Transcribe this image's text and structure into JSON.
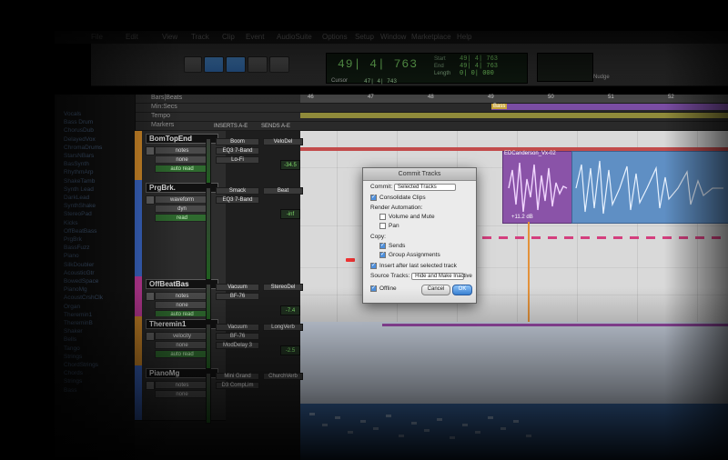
{
  "menu": [
    "File",
    "Edit",
    "View",
    "Track",
    "Clip",
    "Event",
    "AudioSuite",
    "Options",
    "Setup",
    "Window",
    "Marketplace",
    "Help"
  ],
  "transport": {
    "main_counter": "49| 4| 763",
    "start_label": "Start",
    "end_label": "End",
    "length_label": "Length",
    "start_value": "49| 4| 763",
    "end_value": "49| 4| 763",
    "length_value": "0| 0| 000",
    "cursor_label": "Cursor",
    "cursor_value": "47| 4| 743",
    "nudge_label": "Nudge"
  },
  "rulers": {
    "bars_beats_label": "Bars|Beats",
    "min_secs_label": "Min:Secs",
    "tempo_label": "Tempo",
    "markers_label": "Markers",
    "ticks": [
      "46",
      "47",
      "48",
      "49",
      "50",
      "51",
      "52"
    ],
    "marker_name": "Bass"
  },
  "headers": {
    "inserts": "INSERTS A-E",
    "sends": "SENDS A-E"
  },
  "tracks": [
    {
      "name": "BomTopEnd",
      "pill1": "notes",
      "pill2": "none",
      "pill3": "auto read",
      "color": "#e4962c",
      "inserts": [
        "Boom",
        "EQ3 7-Band",
        "Lo-Fi"
      ],
      "send": "VeloDel",
      "fader": "-34.5"
    },
    {
      "name": "PrgBrk.",
      "pill1": "waveform",
      "pill2": "dyn",
      "pill3": "read",
      "color": "#3f6fd6",
      "inserts": [
        "Smack",
        "EQ3 7-Band"
      ],
      "send": "Beat",
      "fader": "-inf"
    },
    {
      "name": "OffBeatBas",
      "pill1": "notes",
      "pill2": "none",
      "pill3": "auto read",
      "color": "#d43fa9",
      "inserts": [
        "Vacuum",
        "BF-76"
      ],
      "send": "StereoDel",
      "fader": "-7.4"
    },
    {
      "name": "Theremin1",
      "pill1": "velocity",
      "pill2": "none",
      "pill3": "auto read",
      "color": "#e4962c",
      "inserts": [
        "Vacuum",
        "BF-76",
        "ModDelay 3"
      ],
      "send": "LongVerb",
      "fader": "-2.5"
    },
    {
      "name": "PianoMg",
      "pill1": "notes",
      "pill2": "none",
      "pill3": "",
      "color": "#3f6fd6",
      "inserts": [
        "Mini Grand",
        "D3 CompLim"
      ],
      "send": "ChurchVerb",
      "fader": ""
    }
  ],
  "clips": [
    "Vocals",
    "Bass Drum",
    "ChorusDub",
    "DelayedVox",
    "ChromaDrums",
    "StarsNBars",
    "BasSynth",
    "RhythmArp",
    "ShakeTamb",
    "Synth Lead",
    "DarkLead",
    "SynthShake",
    "StereoPad",
    "Kicks",
    "OffBeatBass",
    "PrgBrk",
    "BassFuzz",
    "Piano",
    "SilkDoubler",
    "AcousticGtr",
    "BowedSpace",
    "PianoMg",
    "AcoustCrshClk",
    "Organ",
    "Theremin1",
    "ThereminB",
    "Shaker",
    "Bells",
    "Tango",
    "Strings",
    "ChordStrings",
    "Chords",
    "Strings",
    "Bass"
  ],
  "regions": {
    "purple_name": "EDCanderson_Vx-02",
    "purple_footer": "+11.2 dB"
  },
  "dialog": {
    "title": "Commit Tracks",
    "commit_label": "Commit:",
    "commit_value": "Selected Tracks",
    "consolidate_clips": "Consolidate Clips",
    "render_automation": "Render Automation:",
    "volume_mute": "Volume and Mute",
    "pan": "Pan",
    "copy": "Copy:",
    "sends": "Sends",
    "group_assignments": "Group Assignments",
    "insert_after": "Insert after last selected track",
    "source_tracks_label": "Source Tracks:",
    "source_tracks_value": "Hide and Make Inactive",
    "offline": "Offline",
    "cancel": "Cancel",
    "ok": "OK"
  },
  "colors": {
    "accent_blue": "#4d8fdc",
    "track_orange": "#e4962c",
    "track_magenta": "#d43fa9",
    "region_purple": "#8a53a8",
    "counter_green": "#7fdc6a"
  }
}
